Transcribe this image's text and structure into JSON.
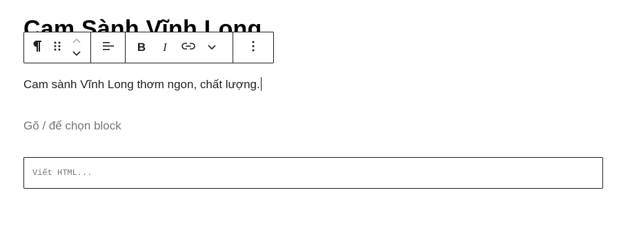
{
  "post": {
    "title": "Cam Sành Vĩnh Long"
  },
  "toolbar": {
    "block_type_icon": "paragraph-icon",
    "drag_icon": "drag-handle-icon",
    "move_up_icon": "chevron-up-icon",
    "move_down_icon": "chevron-down-icon",
    "align_icon": "align-left-icon",
    "bold_label": "B",
    "italic_label": "I",
    "link_icon": "link-icon",
    "more_formats_icon": "chevron-down-icon",
    "options_icon": "more-vertical-icon"
  },
  "paragraph": {
    "text": "Cam sành Vĩnh Long thơm ngon, chất lượng."
  },
  "appender": {
    "placeholder": "Gõ / để chọn block"
  },
  "html_block": {
    "placeholder": "Viết HTML..."
  },
  "colors": {
    "text": "#1e1e1e",
    "placeholder": "#757575",
    "border": "#1e1e1e",
    "background": "#ffffff"
  }
}
